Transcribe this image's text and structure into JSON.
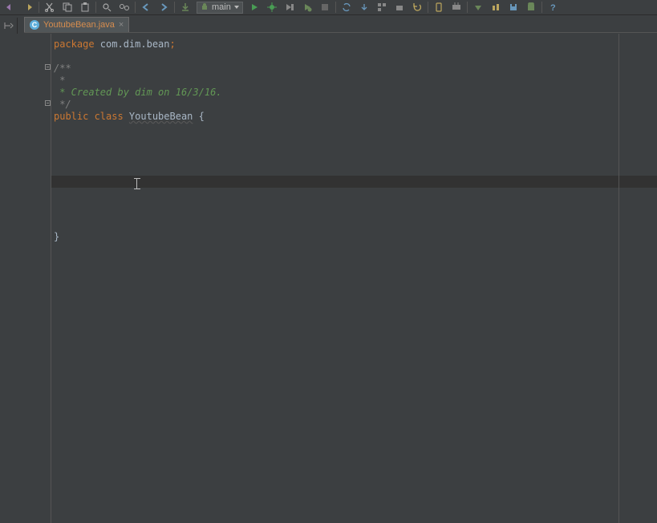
{
  "toolbar": {
    "config_label": "main"
  },
  "tabs": [
    {
      "icon_letter": "C",
      "name": "YoutubeBean.java"
    }
  ],
  "code": {
    "line1_kw": "package",
    "line1_pkg": " com.dim.bean",
    "line1_semi": ";",
    "line3": "/**",
    "line4": " *",
    "line5": " * Created by dim on 16/3/16.",
    "line6": " */",
    "line7_kw": "public class ",
    "line7_cls": "YoutubeBean",
    "line7_brace": " {",
    "line17": "}"
  }
}
